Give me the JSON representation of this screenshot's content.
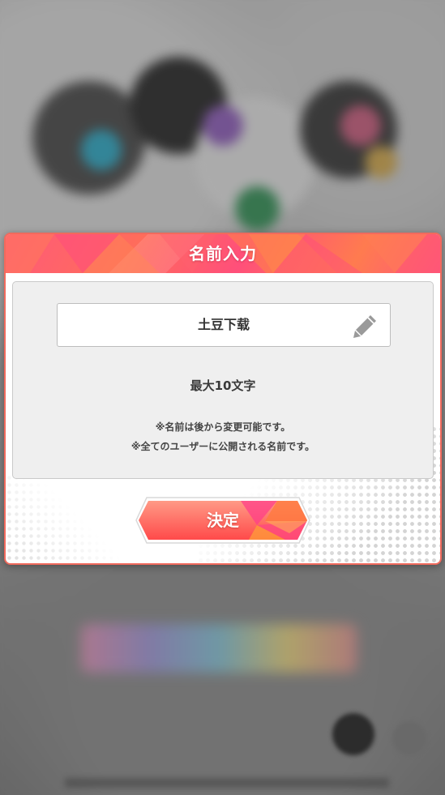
{
  "dialog": {
    "title": "名前入力",
    "name_value": "土豆下载",
    "max_length_hint": "最大10文字",
    "notes": [
      "※名前は後から変更可能です。",
      "※全てのユーザーに公開される名前です。"
    ],
    "confirm_label": "決定",
    "edit_icon": "pencil-icon"
  },
  "colors": {
    "header_accent": "#ff5a79",
    "border_accent": "#f06a5d",
    "button_gradient_start": "#ff8a78",
    "button_gradient_end": "#ff4f4f"
  }
}
